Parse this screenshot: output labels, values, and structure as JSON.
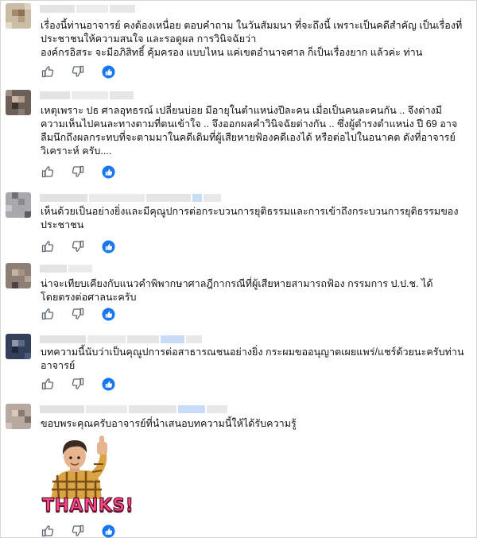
{
  "comments": [
    {
      "id": "c1",
      "text": "เรื่องนี้ท่านอาจารย์ คงต้องเหนื่อย ตอบคำถาม ในวันสัมมนา ที่จะถึงนี้ เพราะเป็นคดีสำคัญ เป็นเรื่องที่ประชาชนให้ความสนใจ และรอดูผล การวินิจฉัยว่า\nองค์กรอิสระ จะมีอภิสิทธิ์ คุ้มครอง แบบไหน แค่เขตอำนาจศาล ก็เป็นเรื่องยาก แล้วค่ะ ท่าน"
    },
    {
      "id": "c2",
      "text": "เหตุเพราะ ปธ ศาลอุทธรณ์ เปลี่ยนบ่อย มีอายุในตำแหน่งปีละคน เมื่อเป็นคนละคนกัน .. จึงต่างมีความเห็นไปคนละทางตามที่ตนเข้าใจ .. จึงออกผลคำวินิจฉัยต่างกัน .. ซึ่งผู้ดำรงตำแหน่ง ปี 69 อาจลืมนึกถึงผลกระทบที่จะตามมาในคดีเดิมที่ผู้เสียหายฟ้องคดีเองได้ หรือต่อไปในอนาคต ดังที่อาจารย์วิเคราะห์ ครับ...."
    },
    {
      "id": "c3",
      "text": "เห็นด้วยเป็นอย่างยิ่งและมีคุณูปการต่อกระบวนการยุติธรรมและการเข้าถึงกระบวนการยุติธรรมของประชาชน"
    },
    {
      "id": "c4",
      "text": "น่าจะเทียบเคียงกับแนวคำพิพากษาศาลฎีกากรณีที่ผู้เสียหายสามารถฟ้อง กรรมการ ป.ป.ช. ได้โดยตรงต่อศาลนะครับ"
    },
    {
      "id": "c5",
      "text": "บทความนี้นับว่าเป็นคุณูปการต่อสาธารณชนอย่างยิ่ง กระผมขออนุญาตเผยแพร่/แชร์ด้วยนะครับท่านอาจารย์"
    },
    {
      "id": "c6",
      "text": "ขอบพระคุณครับอาจารย์ที่นำเสนอบทความนี้ให้ได้รับความรู้",
      "sticker_text": "THANKS!"
    }
  ],
  "icons": {
    "like": "thumbs-up-icon",
    "dislike": "thumbs-down-icon",
    "reaction": "blue-like-badge-icon"
  },
  "colors": {
    "reaction_blue": "#1877f2",
    "text": "#111111",
    "icon_gray": "#606770",
    "sticker_pink": "#ff4a86"
  }
}
